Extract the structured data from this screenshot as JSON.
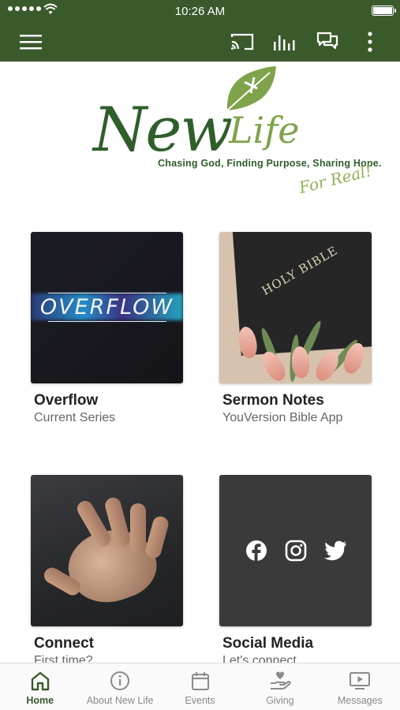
{
  "status_bar": {
    "time": "10:26 AM"
  },
  "toolbar": {
    "icons": [
      "menu-icon",
      "cast-icon",
      "audio-bars-icon",
      "chat-icon",
      "more-vertical-icon"
    ]
  },
  "logo": {
    "new": "New",
    "life": "Life",
    "tagline": "Chasing God, Finding Purpose, Sharing Hope.",
    "for_real": "For Real!"
  },
  "cards": [
    {
      "title": "Overflow",
      "subtitle": "Current Series",
      "image_text": "OVERFLOW"
    },
    {
      "title": "Sermon Notes",
      "subtitle": "YouVersion Bible App",
      "image_text": "HOLY BIBLE"
    },
    {
      "title": "Connect",
      "subtitle": "First time?"
    },
    {
      "title": "Social Media",
      "subtitle": "Let's connect",
      "icons": [
        "facebook-icon",
        "instagram-icon",
        "twitter-icon"
      ]
    }
  ],
  "bottom_nav": {
    "items": [
      {
        "label": "Home",
        "icon": "home-icon",
        "active": true
      },
      {
        "label": "About New Life",
        "icon": "info-icon",
        "active": false
      },
      {
        "label": "Events",
        "icon": "calendar-icon",
        "active": false
      },
      {
        "label": "Giving",
        "icon": "giving-hand-icon",
        "active": false
      },
      {
        "label": "Messages",
        "icon": "play-video-icon",
        "active": false
      }
    ]
  },
  "colors": {
    "primary": "#3a5a2b",
    "logo_dark": "#2f5e2b",
    "logo_light": "#7fa34a"
  }
}
